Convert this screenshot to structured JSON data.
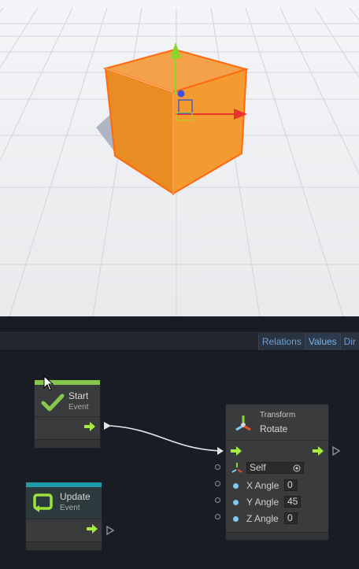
{
  "tabs": [
    "Relations",
    "Values",
    "Dir"
  ],
  "nodes": {
    "start": {
      "title": "Start",
      "subtitle": "Event",
      "color": "#86c84c"
    },
    "update": {
      "title": "Update",
      "subtitle": "Event",
      "color": "#1e9aa8"
    },
    "rotate": {
      "title": "Transform",
      "subtitle": "Rotate",
      "target": "Self",
      "params": [
        {
          "label": "X Angle",
          "value": "0"
        },
        {
          "label": "Y Angle",
          "value": "45"
        },
        {
          "label": "Z Angle",
          "value": "0"
        }
      ]
    }
  },
  "colors": {
    "flow_arrow": "#a6ec3f",
    "cube": "#f08e1e",
    "selection": "#ff6a10"
  },
  "icons": [
    "checkmark-icon",
    "update-loop-icon",
    "transform-icon",
    "target-icon",
    "cursor-icon"
  ]
}
